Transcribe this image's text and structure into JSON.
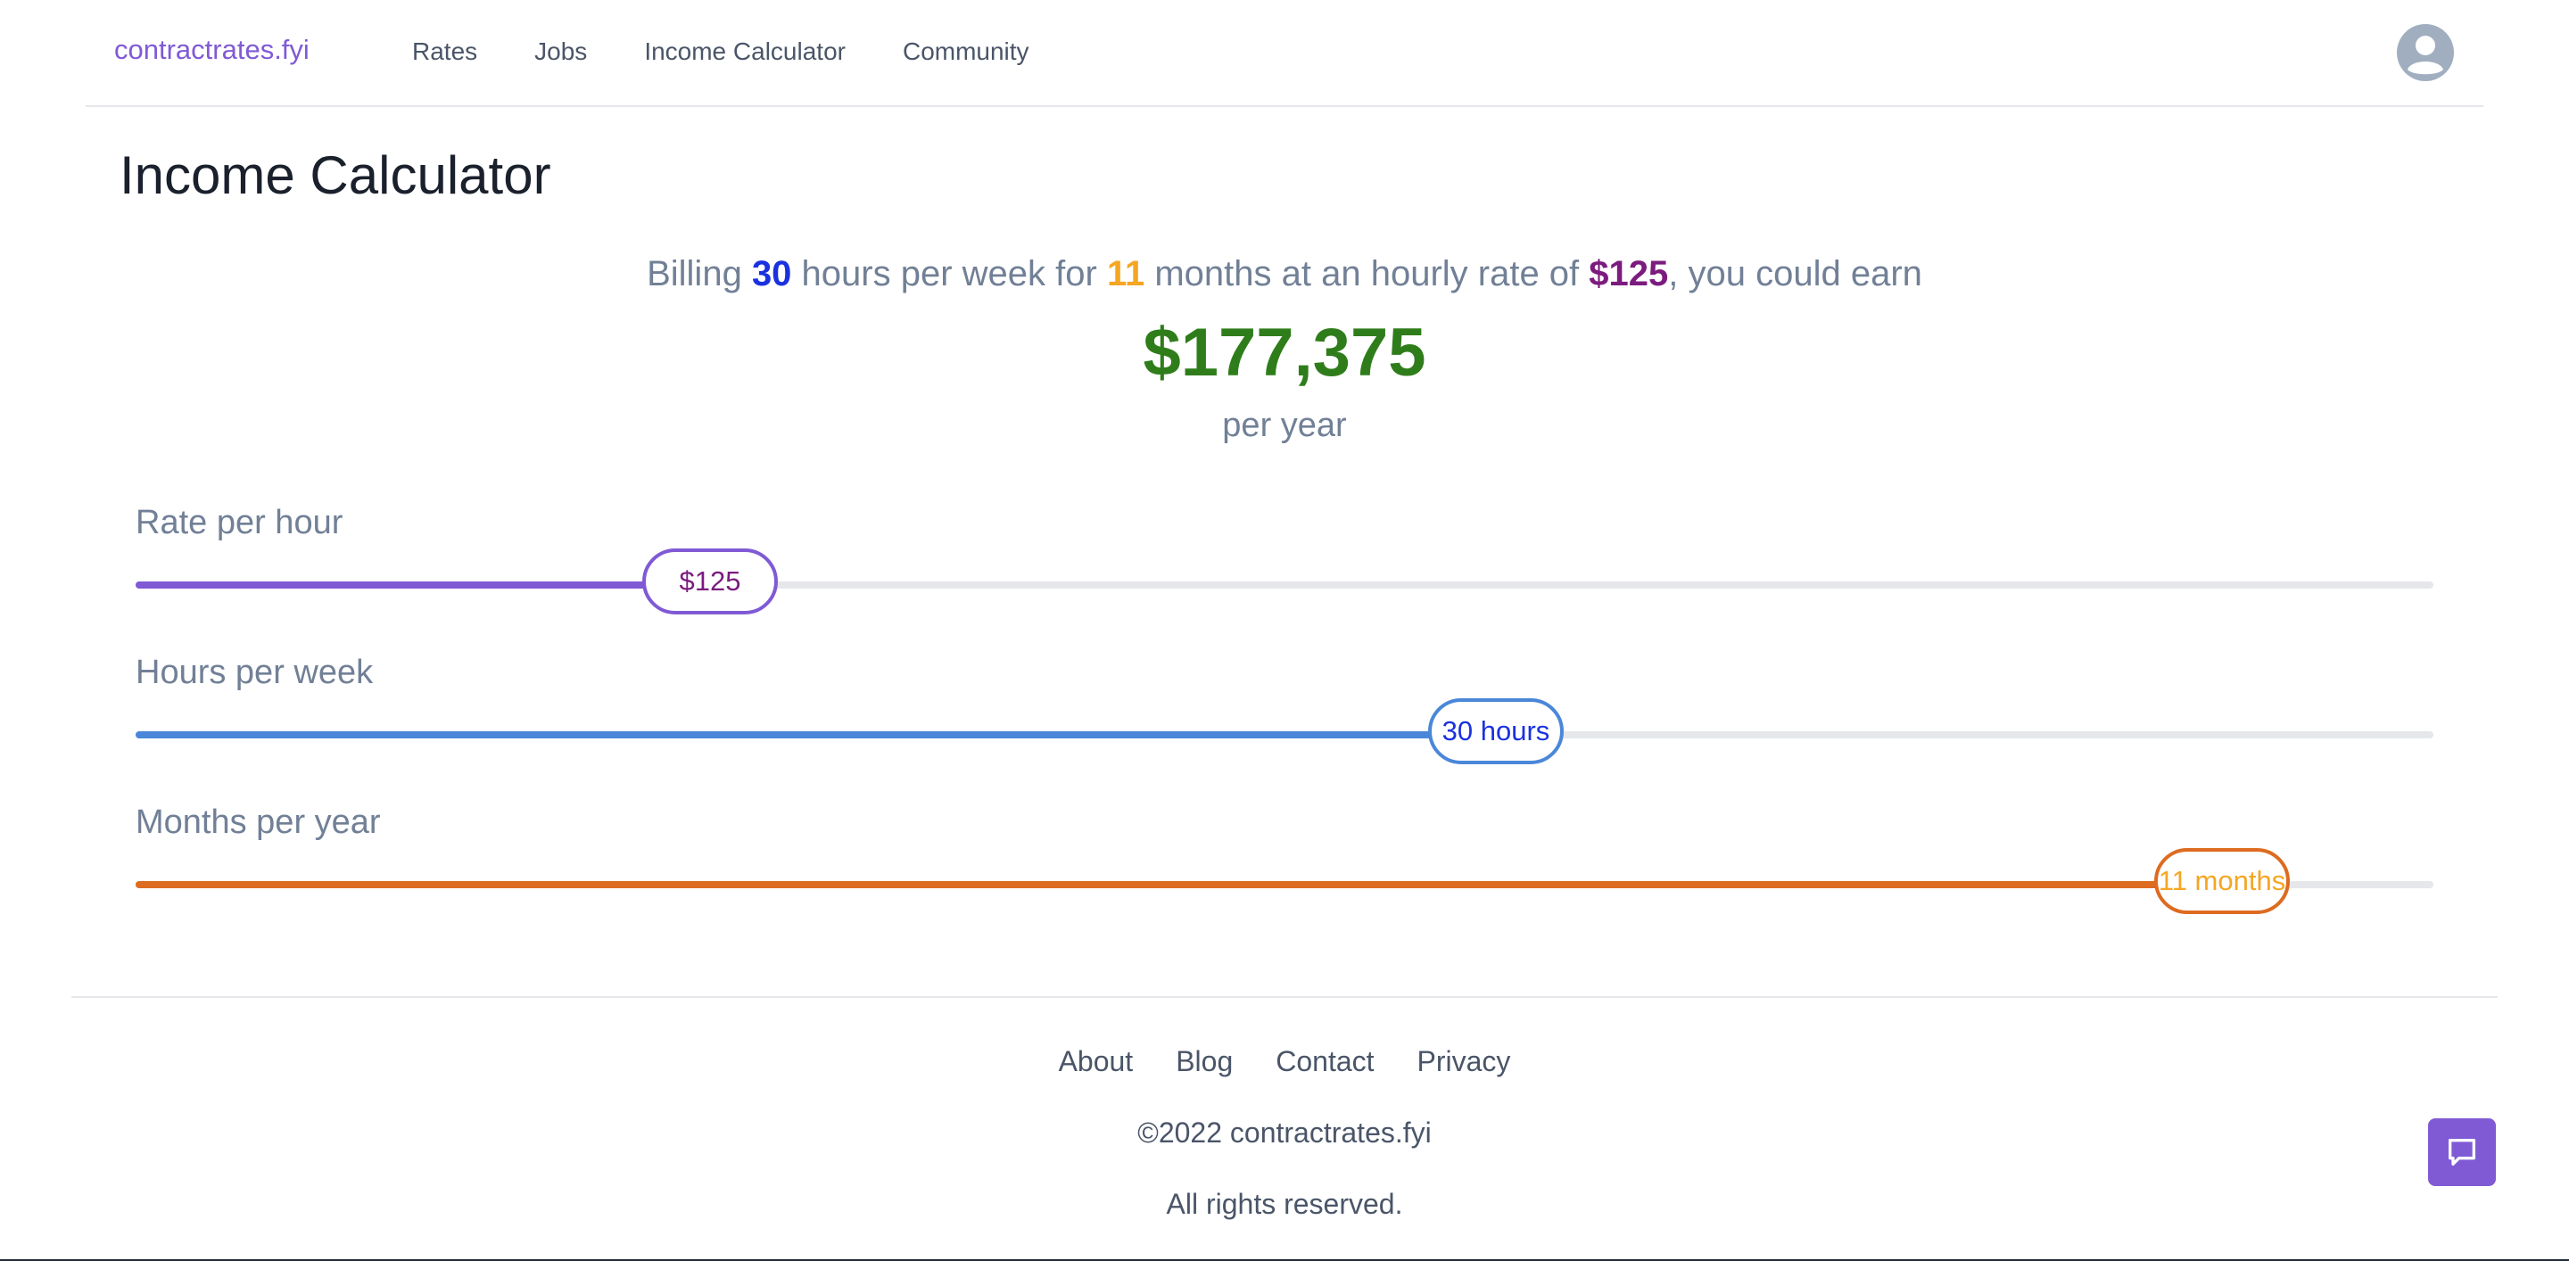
{
  "header": {
    "brand": "contractrates.fyi",
    "nav": [
      "Rates",
      "Jobs",
      "Income Calculator",
      "Community"
    ],
    "avatar_icon": "user-circle-icon"
  },
  "main": {
    "title": "Income Calculator",
    "summary": {
      "prefix": "Billing ",
      "hours": "30",
      "mid1": " hours per week for ",
      "months": "11",
      "mid2": " months at an hourly rate of ",
      "rate": "$125",
      "suffix": ", you could earn"
    },
    "total": "$177,375",
    "total_unit": "per year",
    "sliders": [
      {
        "label": "Rate per hour",
        "value_text": "$125",
        "fraction": 0.25,
        "color": "#805ad5",
        "text_color": "#7b1b7e"
      },
      {
        "label": "Hours per week",
        "value_text": "30 hours",
        "fraction": 0.592,
        "color": "#4a87d9",
        "text_color": "#1a31e0"
      },
      {
        "label": "Months per year",
        "value_text": "11 months",
        "fraction": 0.908,
        "color": "#dd6b20",
        "text_color": "#f5a623"
      }
    ]
  },
  "footer": {
    "links": [
      "About",
      "Blog",
      "Contact",
      "Privacy"
    ],
    "copyright": "©2022 contractrates.fyi",
    "rights": "All rights reserved.",
    "chat_icon": "chat-bubble-icon",
    "chat_color": "#805ad5"
  }
}
